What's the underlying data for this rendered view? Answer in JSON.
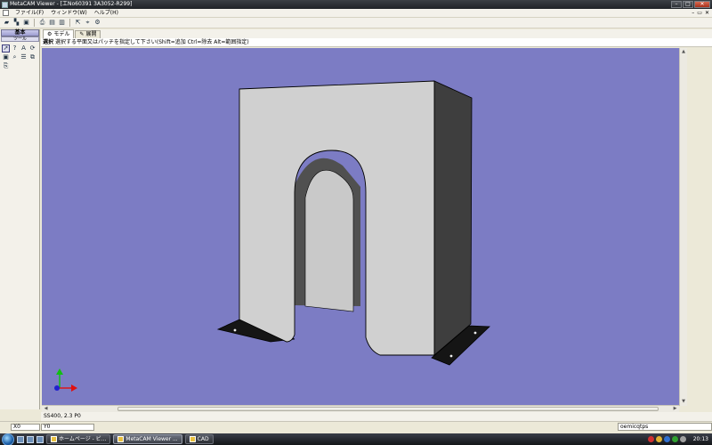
{
  "window": {
    "title": "MetaCAM Viewer - [工No60391 3A3052-R299]",
    "controls": {
      "minimize": "–",
      "maximize": "□",
      "close": "✕"
    }
  },
  "menu": {
    "items": [
      "ファイル(F)",
      "ウィンドウ(W)",
      "ヘルプ(H)"
    ],
    "mdi_controls": {
      "minimize": "–",
      "restore": "▭",
      "close": "✕"
    }
  },
  "toolbar": {
    "icons": [
      "open-folder-icon",
      "open-multi-icon",
      "save-icon",
      "print-icon",
      "print-preview-icon",
      "page-setup-icon",
      "export-icon",
      "measure-icon",
      "settings-icon"
    ]
  },
  "left_panel": {
    "tab_basic": "基本",
    "tab_tools": "ツール",
    "tools": [
      "select-arrow-icon",
      "help-arrow-icon",
      "text-icon",
      "rotate-icon",
      "window-icon",
      "zoom-icon",
      "list-icon",
      "layers-icon",
      "copy-icon"
    ]
  },
  "doc_tabs": [
    {
      "label": "モデル",
      "active": true
    },
    {
      "label": "展開",
      "active": false
    }
  ],
  "status": {
    "mode": "選択",
    "instruction": "選択する平面又はパッチを指定して下さい(Shift=追加 Ctrl=除去 Alt=範囲指定)"
  },
  "viewport": {
    "background": "#7c7cc4"
  },
  "material": "SS400, 2.3 P0",
  "coords": {
    "x_label": "X0",
    "y_label": "Y0",
    "user": "oemicqtps"
  },
  "taskbar": {
    "tasks": [
      {
        "label": "ホームページ - ビ...",
        "active": false
      },
      {
        "label": "MetaCAM Viewer ...",
        "active": true
      },
      {
        "label": "CAD",
        "active": false
      }
    ],
    "clock": "20:13"
  }
}
